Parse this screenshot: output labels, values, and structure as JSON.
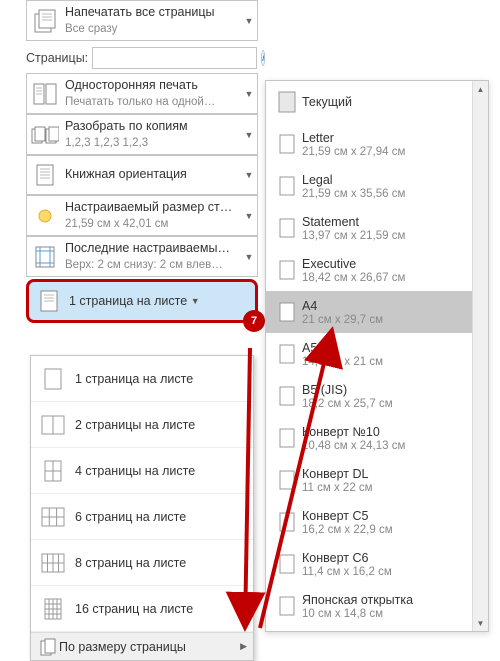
{
  "top_option": {
    "title": "Напечатать все страницы",
    "sub": "Все сразу"
  },
  "pages_label": "Страницы:",
  "pages_value": "",
  "options": [
    {
      "title": "Односторонняя печать",
      "sub": "Печатать только на одной…"
    },
    {
      "title": "Разобрать по копиям",
      "sub": "1,2,3    1,2,3    1,2,3"
    },
    {
      "title": "Книжная ориентация",
      "sub": ""
    },
    {
      "title": "Настраиваемый размер ст…",
      "sub": "21,59 см x 42,01 см"
    },
    {
      "title": "Последние настраиваемы…",
      "sub": "Верх: 2 см снизу: 2 см влев…"
    }
  ],
  "selected_option": {
    "title": "1 страница на листе"
  },
  "badge": "7",
  "pages_menu": [
    "1 страница на листе",
    "2 страницы на листе",
    "4 страницы на листе",
    "6 страниц на листе",
    "8 страниц на листе",
    "16 страниц на листе"
  ],
  "menu_footer": "По размеру страницы",
  "sizes_header": "Текущий",
  "sizes": [
    {
      "name": "Letter",
      "dim": "21,59 см x 27,94 см",
      "selected": false
    },
    {
      "name": "Legal",
      "dim": "21,59 см x 35,56 см",
      "selected": false
    },
    {
      "name": "Statement",
      "dim": "13,97 см x 21,59 см",
      "selected": false
    },
    {
      "name": "Executive",
      "dim": "18,42 см x 26,67 см",
      "selected": false
    },
    {
      "name": "A4",
      "dim": "21 см x 29,7 см",
      "selected": true
    },
    {
      "name": "A5",
      "dim": "14,8 см x 21 см",
      "selected": false
    },
    {
      "name": "B5 (JIS)",
      "dim": "18,2 см x 25,7 см",
      "selected": false
    },
    {
      "name": "Конверт №10",
      "dim": "10,48 см x 24,13 см",
      "selected": false
    },
    {
      "name": "Конверт DL",
      "dim": "11 см x 22 см",
      "selected": false
    },
    {
      "name": "Конверт C5",
      "dim": "16,2 см x 22,9 см",
      "selected": false
    },
    {
      "name": "Конверт C6",
      "dim": "11,4 см x 16,2 см",
      "selected": false
    },
    {
      "name": "Японская открытка",
      "dim": "10 см x 14,8 см",
      "selected": false
    }
  ]
}
